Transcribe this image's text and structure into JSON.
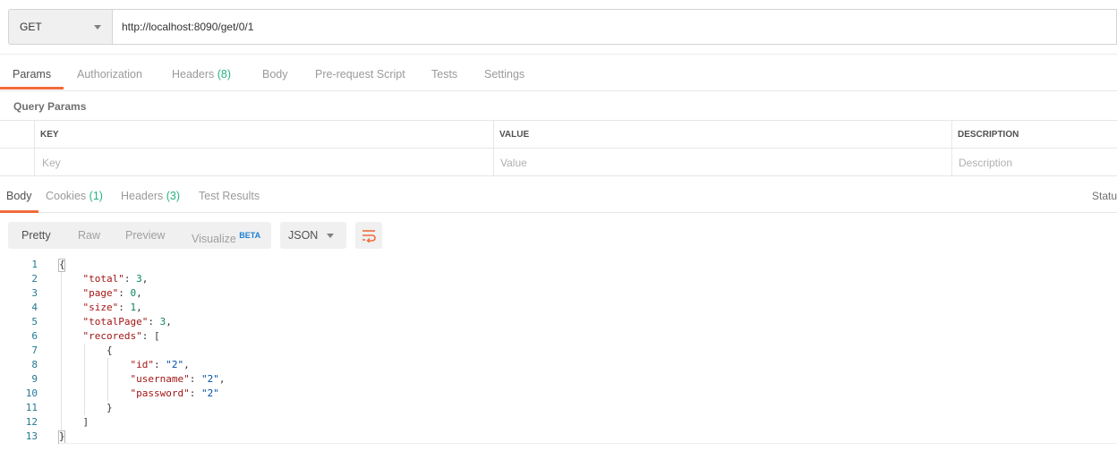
{
  "request": {
    "method": "GET",
    "url": "http://localhost:8090/get/0/1"
  },
  "request_tabs": [
    {
      "label": "Params",
      "count": ""
    },
    {
      "label": "Authorization",
      "count": ""
    },
    {
      "label": "Headers",
      "count": "(8)"
    },
    {
      "label": "Body",
      "count": ""
    },
    {
      "label": "Pre-request Script",
      "count": ""
    },
    {
      "label": "Tests",
      "count": ""
    },
    {
      "label": "Settings",
      "count": ""
    }
  ],
  "query_params": {
    "title": "Query Params",
    "columns": [
      "KEY",
      "VALUE",
      "DESCRIPTION"
    ],
    "placeholders": [
      "Key",
      "Value",
      "Description"
    ]
  },
  "response_tabs": [
    {
      "label": "Body",
      "count": ""
    },
    {
      "label": "Cookies",
      "count": "(1)"
    },
    {
      "label": "Headers",
      "count": "(3)"
    },
    {
      "label": "Test Results",
      "count": ""
    }
  ],
  "status_label": "Statu",
  "format_tabs": [
    "Pretty",
    "Raw",
    "Preview",
    "Visualize"
  ],
  "visualize_badge": "BETA",
  "language": "JSON",
  "icons": {
    "dropdown": "chevron-down-icon",
    "wrap": "wrap-lines-icon"
  },
  "colors": {
    "accent": "#f26b3a",
    "count": "#26b47f",
    "line_number": "#237893",
    "json_key": "#a31515",
    "json_number": "#09885a",
    "json_string": "#0451a5"
  },
  "code_lines": [
    "{",
    "    \"total\": 3,",
    "    \"page\": 0,",
    "    \"size\": 1,",
    "    \"totalPage\": 3,",
    "    \"recoreds\": [",
    "        {",
    "            \"id\": \"2\",",
    "            \"username\": \"2\",",
    "            \"password\": \"2\"",
    "        }",
    "    ]",
    "}"
  ]
}
